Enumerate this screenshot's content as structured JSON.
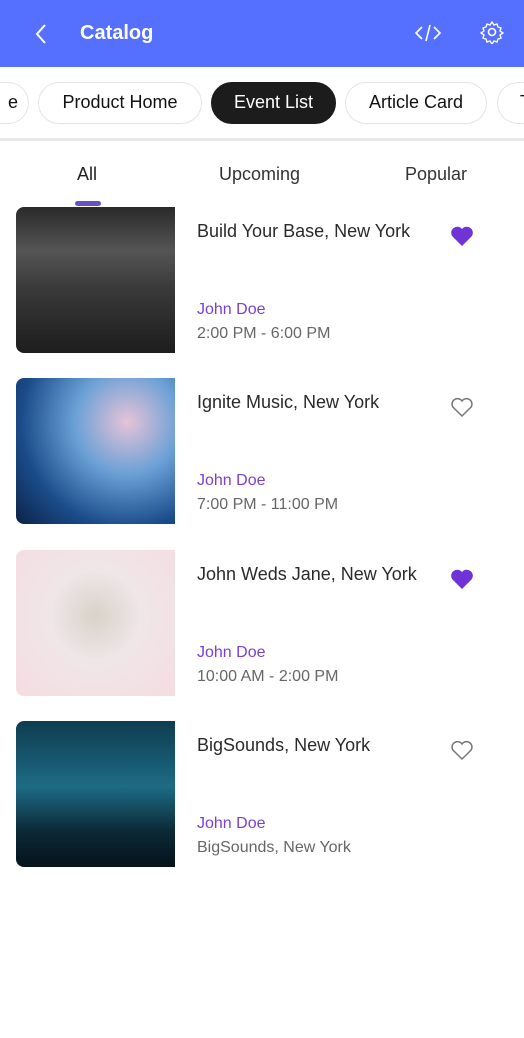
{
  "header": {
    "title": "Catalog",
    "back_icon": "chevron-left-icon",
    "code_icon": "code-icon",
    "settings_icon": "gear-icon",
    "color": "#5570ff"
  },
  "chips": [
    {
      "label": "e"
    },
    {
      "label": "Product Home"
    },
    {
      "label": "Event List",
      "active": true
    },
    {
      "label": "Article Card"
    },
    {
      "label": "T"
    }
  ],
  "tabs": [
    {
      "label": "All",
      "active": true
    },
    {
      "label": "Upcoming"
    },
    {
      "label": "Popular"
    }
  ],
  "events": [
    {
      "title": "Build Your Base, New York",
      "organizer": "John Doe",
      "subtitle": "2:00 PM - 6:00 PM",
      "favorite": true
    },
    {
      "title": "Ignite Music, New York",
      "organizer": "John Doe",
      "subtitle": "7:00 PM - 11:00 PM",
      "favorite": false
    },
    {
      "title": "John Weds Jane, New York",
      "organizer": "John Doe",
      "subtitle": "10:00 AM - 2:00 PM",
      "favorite": true
    },
    {
      "title": "BigSounds, New York",
      "organizer": "John Doe",
      "subtitle": "BigSounds, New York",
      "favorite": false
    }
  ],
  "colors": {
    "accent": "#7b3fd6",
    "heart": "#7033d8"
  }
}
